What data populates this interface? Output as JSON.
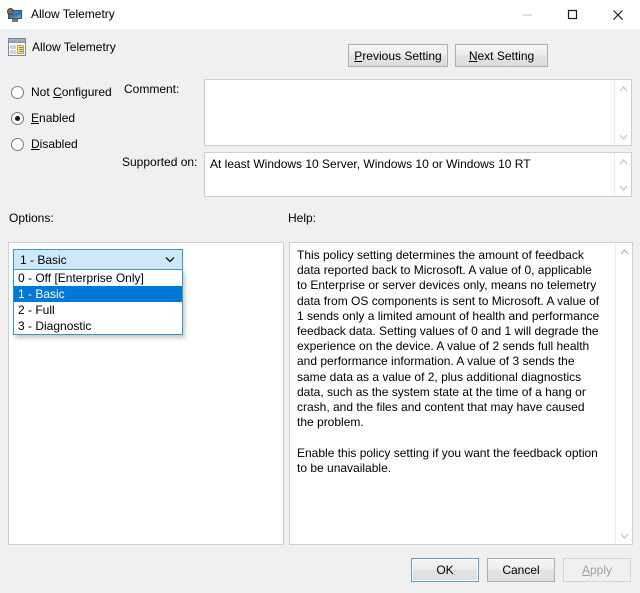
{
  "window": {
    "title": "Allow Telemetry",
    "icon": "policy-monitor-icon",
    "controls": {
      "minimize_label": "Minimize",
      "maximize_label": "Maximize",
      "close_label": "Close"
    }
  },
  "header": {
    "title": "Allow Telemetry",
    "icon": "group-policy-setting-icon",
    "previous_setting": "Previous Setting",
    "previous_setting_accel": "P",
    "next_setting": "Next Setting",
    "next_setting_accel": "N"
  },
  "state_radios": {
    "options": [
      {
        "label": "Not Configured",
        "accel": "C",
        "prefix": "Not ",
        "suffix": "onfigured",
        "checked": false
      },
      {
        "label": "Enabled",
        "accel": "E",
        "prefix": "",
        "suffix": "nabled",
        "checked": true
      },
      {
        "label": "Disabled",
        "accel": "D",
        "prefix": "",
        "suffix": "isabled",
        "checked": false
      }
    ]
  },
  "comment": {
    "label": "Comment:",
    "value": "",
    "placeholder": ""
  },
  "supported_on": {
    "label": "Supported on:",
    "value": "At least Windows 10 Server, Windows 10 or Windows 10 RT"
  },
  "options_section": {
    "label": "Options:",
    "combo": {
      "name": "telemetry-level",
      "selected": "1 - Basic",
      "expanded": true,
      "items": [
        {
          "label": "0 - Off [Enterprise Only]",
          "selected": false
        },
        {
          "label": "1 - Basic",
          "selected": true
        },
        {
          "label": "2 - Full",
          "selected": false
        },
        {
          "label": "3 - Diagnostic",
          "selected": false
        }
      ]
    }
  },
  "help_section": {
    "label": "Help:",
    "text": "This policy setting determines the amount of feedback data reported back to Microsoft. A value of 0, applicable to Enterprise or server devices only, means no telemetry data from OS components is sent to Microsoft. A value of 1 sends only a limited amount of health and performance feedback data. Setting values of 0 and 1 will degrade the experience on the device. A value of 2 sends full health and performance information. A value of 3 sends the same data as a value of 2, plus additional diagnostics data, such as the system state at the time of a hang or crash, and the files and content that may have caused the problem.\n\nEnable this policy setting if you want the feedback option to be unavailable."
  },
  "footer": {
    "ok": "OK",
    "cancel": "Cancel",
    "apply": "Apply",
    "apply_accel": "A",
    "apply_enabled": false
  },
  "colors": {
    "window_bg": "#f0f0f0",
    "titlebar_bg": "#ffffff",
    "field_bg": "#ffffff",
    "highlight": "#0078d7",
    "focus_border": "#3c94c8",
    "combo_bg": "#cde8f8",
    "button_border": "#adadad",
    "default_button_border": "#5a9fd4",
    "disabled_text": "#a0a0a0"
  }
}
